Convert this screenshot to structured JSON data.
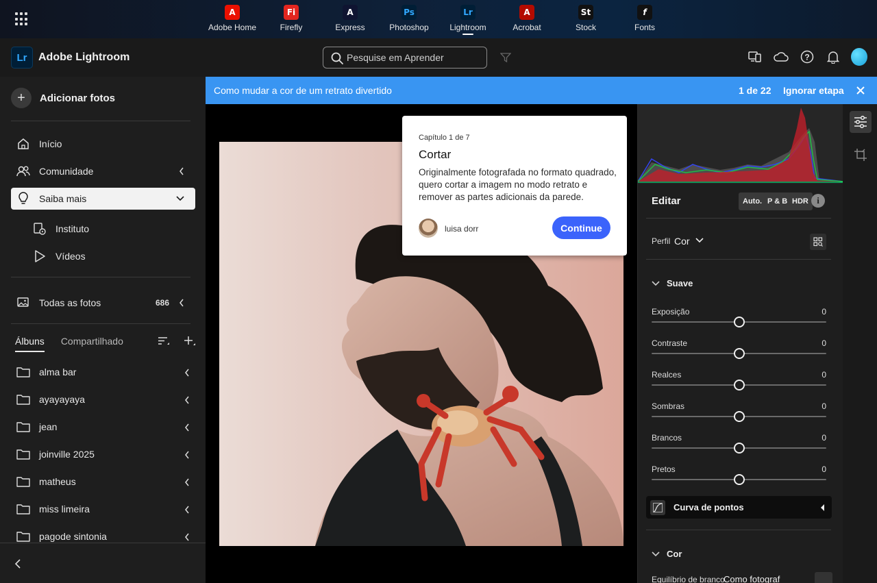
{
  "appbar": {
    "apps": [
      {
        "label": "Adobe Home",
        "icon": "adobe-icon",
        "color": "#eb1000",
        "glyph": "A"
      },
      {
        "label": "Firefly",
        "icon": "firefly-icon",
        "color": "#e3261f",
        "glyph": "Fi"
      },
      {
        "label": "Express",
        "icon": "express-icon",
        "color": "#0f1431",
        "glyph": "A"
      },
      {
        "label": "Photoshop",
        "icon": "photoshop-icon",
        "color": "#001e36",
        "glyph": "Ps"
      },
      {
        "label": "Lightroom",
        "icon": "lightroom-icon",
        "color": "#001e36",
        "glyph": "Lr",
        "active": true
      },
      {
        "label": "Acrobat",
        "icon": "acrobat-icon",
        "color": "#b30b00",
        "glyph": "A"
      },
      {
        "label": "Stock",
        "icon": "stock-icon",
        "color": "#111111",
        "glyph": "St"
      },
      {
        "label": "Fonts",
        "icon": "fonts-icon",
        "color": "#111111",
        "glyph": "f"
      }
    ]
  },
  "header": {
    "logo_glyph": "Lr",
    "title": "Adobe Lightroom",
    "search_placeholder": "Pesquise em Aprender"
  },
  "sidebar": {
    "add_photos": "Adicionar fotos",
    "nav": {
      "inicio": "Início",
      "comunidade": "Comunidade",
      "saiba_mais": "Saiba mais",
      "instituto": "Instituto",
      "videos": "Vídeos",
      "todas_fotos": "Todas as fotos",
      "todas_fotos_count": "686"
    },
    "tabs": {
      "albuns": "Álbuns",
      "compartilhado": "Compartilhado"
    },
    "albums": [
      "alma bar",
      "ayayayaya",
      "jean",
      "joinville 2025",
      "matheus",
      "miss limeira",
      "pagode sintonia"
    ]
  },
  "banner": {
    "title": "Como mudar a cor de um retrato divertido",
    "counter": "1 de 22",
    "skip": "Ignorar etapa"
  },
  "popover": {
    "chapter": "Capítulo 1 de 7",
    "title": "Cortar",
    "description": "Originalmente fotografada no formato quadrado, quero cortar a imagem no modo retrato e remover as partes adicionais da parede.",
    "author": "luisa dorr",
    "continue": "Continue"
  },
  "edit_panel": {
    "title": "Editar",
    "buttons": {
      "auto": "Auto.",
      "pb": "P & B",
      "hdr": "HDR"
    },
    "perfil_label": "Perfil",
    "perfil_value": "Cor",
    "section_suave": "Suave",
    "sliders": [
      {
        "label": "Exposição",
        "value": "0",
        "position": 0.5
      },
      {
        "label": "Contraste",
        "value": "0",
        "position": 0.5
      },
      {
        "label": "Realces",
        "value": "0",
        "position": 0.5
      },
      {
        "label": "Sombras",
        "value": "0",
        "position": 0.5
      },
      {
        "label": "Brancos",
        "value": "0",
        "position": 0.5
      },
      {
        "label": "Pretos",
        "value": "0",
        "position": 0.5
      }
    ],
    "curve_label": "Curva de pontos",
    "section_cor": "Cor",
    "wb_label": "Equilíbrio de branco",
    "wb_value": "Como fotograf"
  }
}
